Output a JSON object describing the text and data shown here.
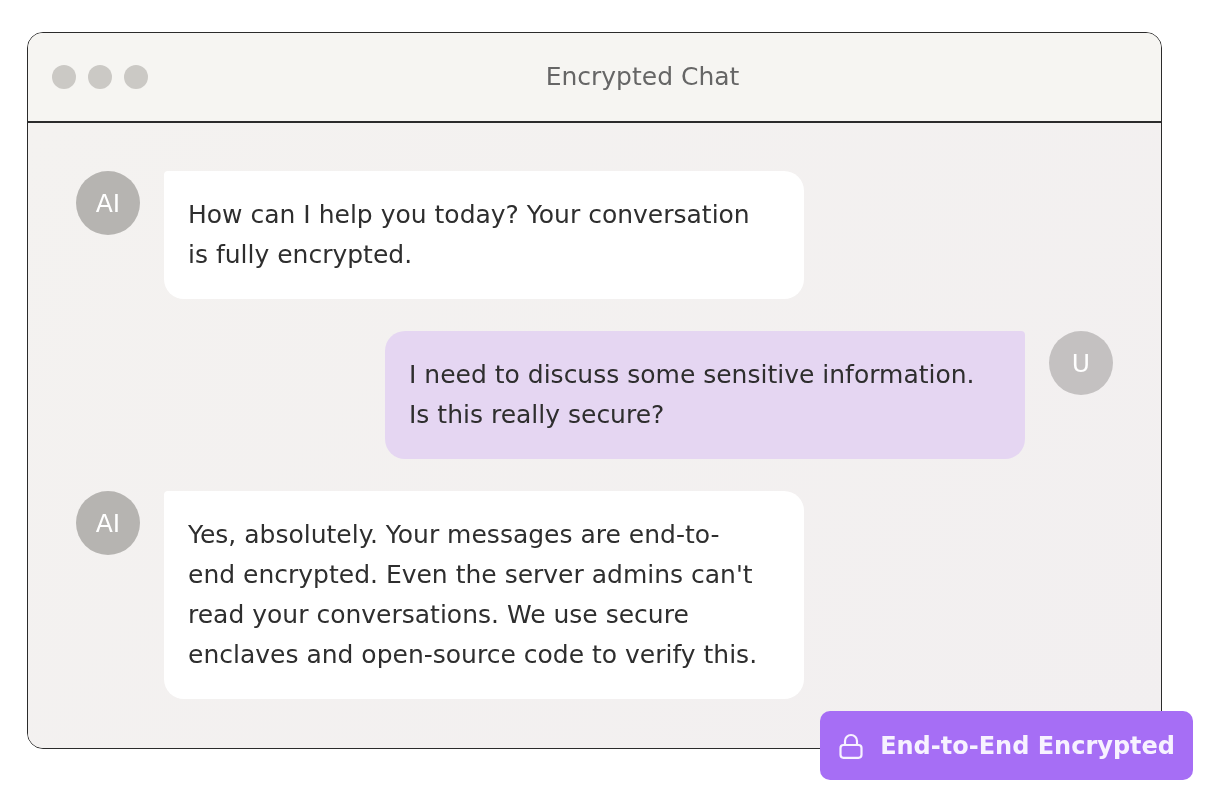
{
  "window": {
    "title": "Encrypted Chat"
  },
  "messages": [
    {
      "kind": "assistant",
      "avatar": "AI",
      "text": "How can I help you today? Your conversation is fully encrypted."
    },
    {
      "kind": "user",
      "avatar": "U",
      "text": "I need to discuss some sensitive information. Is this really secure?"
    },
    {
      "kind": "assistant",
      "avatar": "AI",
      "text": "Yes, absolutely. Your messages are end-to-end encrypted. Even the server admins can't read your conversations. We use secure enclaves and open-source code to verify this."
    }
  ],
  "badge": {
    "label": "End-to-End Encrypted"
  }
}
